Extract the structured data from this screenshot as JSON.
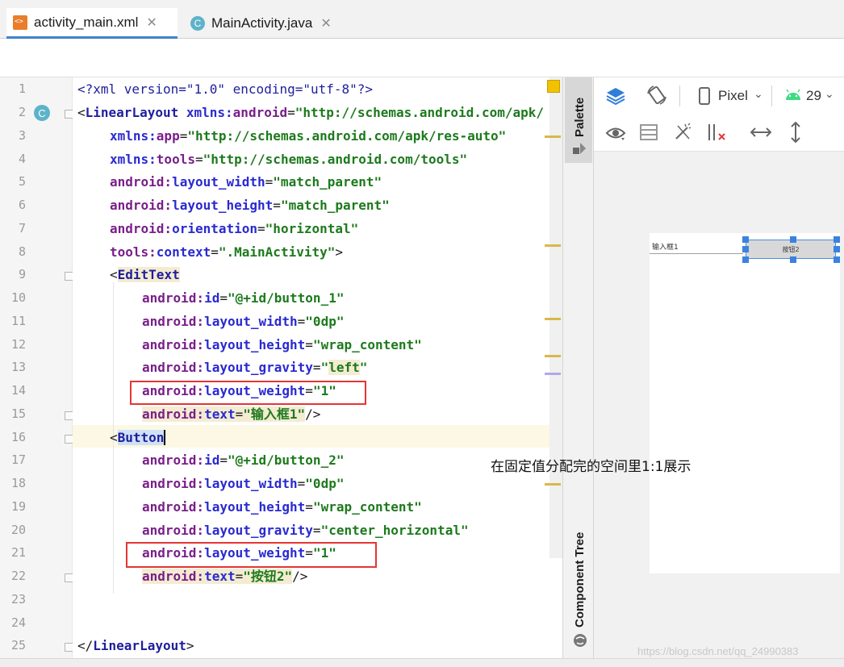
{
  "tabs": [
    {
      "label": "activity_main.xml",
      "icon": "xml-file-icon",
      "active": true
    },
    {
      "label": "MainActivity.java",
      "icon": "java-class-icon",
      "active": false
    }
  ],
  "editor": {
    "line_numbers": [
      "1",
      "2",
      "3",
      "4",
      "5",
      "6",
      "7",
      "8",
      "9",
      "10",
      "11",
      "12",
      "13",
      "14",
      "15",
      "16",
      "17",
      "18",
      "19",
      "20",
      "21",
      "22",
      "23",
      "24",
      "25"
    ],
    "lines": [
      [
        "<?xml version=\"1.0\" encoding=\"utf-8\"?>"
      ],
      [
        "<",
        "LinearLayout",
        " xmlns:",
        "android",
        "=",
        "\"http://schemas.android.com/apk/"
      ],
      [
        "xmlns:",
        "app",
        "=",
        "\"http://schemas.android.com/apk/res-auto\""
      ],
      [
        "xmlns:",
        "tools",
        "=",
        "\"http://schemas.android.com/tools\""
      ],
      [
        "android:",
        "layout_width",
        "=",
        "\"match_parent\""
      ],
      [
        "android:",
        "layout_height",
        "=",
        "\"match_parent\""
      ],
      [
        "android:",
        "orientation",
        "=",
        "\"horizontal\""
      ],
      [
        "tools:",
        "context",
        "=",
        "\".MainActivity\"",
        ">"
      ],
      [
        "<",
        "EditText"
      ],
      [
        "android:",
        "id",
        "=",
        "\"@+id/button_1\""
      ],
      [
        "android:",
        "layout_width",
        "=",
        "\"0dp\""
      ],
      [
        "android:",
        "layout_height",
        "=",
        "\"wrap_content\""
      ],
      [
        "android:",
        "layout_gravity",
        "=",
        "\"",
        "left",
        "\""
      ],
      [
        "android:",
        "layout_weight",
        "=",
        "\"1\""
      ],
      [
        "android:",
        "text",
        "=",
        "\"输入框1\"",
        "/>"
      ],
      [
        "<",
        "Button"
      ],
      [
        "android:",
        "id",
        "=",
        "\"@+id/button_2\""
      ],
      [
        "android:",
        "layout_width",
        "=",
        "\"0dp\""
      ],
      [
        "android:",
        "layout_height",
        "=",
        "\"wrap_content\""
      ],
      [
        "android:",
        "layout_gravity",
        "=",
        "\"center_horizontal\""
      ],
      [
        "android:",
        "layout_weight",
        "=",
        "\"1\""
      ],
      [
        "android:",
        "text",
        "=",
        "\"按钮2\"",
        "/>"
      ],
      [
        ""
      ],
      [
        ""
      ],
      [
        "</",
        "LinearLayout",
        ">"
      ]
    ]
  },
  "side_panel": {
    "palette_label": "Palette",
    "component_tree_label": "Component Tree"
  },
  "design_toolbar": {
    "device": "Pixel",
    "api_level": "29",
    "icons": [
      "layers-icon",
      "orientation-icon",
      "device-icon",
      "android-icon",
      "eye-icon",
      "blueprint-icon",
      "magic-constraint-icon",
      "clear-constraints-icon",
      "expand-horizontal-icon",
      "expand-vertical-icon"
    ]
  },
  "preview": {
    "edittext_text": "输入框1",
    "button_text": "按钮2"
  },
  "annotation": "在固定值分配完的空间里1:1展示",
  "watermark": "https://blog.csdn.net/qq_24990383",
  "colors": {
    "tag": "#1f1f9c",
    "attr": "#2a2ad1",
    "namespace": "#7a1f8a",
    "value": "#1d7a1d",
    "highlight_box": "#e53535",
    "selection": "#3a82e0"
  }
}
